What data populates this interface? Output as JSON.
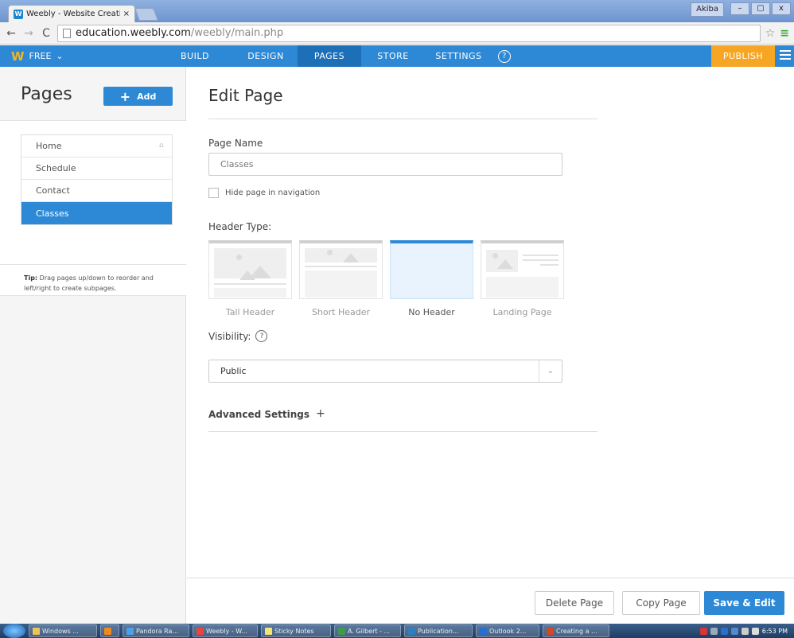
{
  "browser": {
    "tab_title": "Weebly - Website Creatio",
    "tab_close": "×",
    "url_host": "education.weebly.com",
    "url_path": "/weebly/main.php",
    "user_name": "Akiba",
    "min_label": "–",
    "max_label": "▢",
    "close_label": "x"
  },
  "topnav": {
    "plan_label": "FREE",
    "items": [
      "BUILD",
      "DESIGN",
      "PAGES",
      "STORE",
      "SETTINGS"
    ],
    "active": "PAGES",
    "help_label": "?",
    "publish_label": "PUBLISH"
  },
  "sidebar": {
    "title": "Pages",
    "add_label": "Add",
    "pages": [
      {
        "label": "Home",
        "home": true
      },
      {
        "label": "Schedule"
      },
      {
        "label": "Contact"
      },
      {
        "label": "Classes",
        "active": true
      }
    ],
    "tip_label": "Tip:",
    "tip_text": "Drag pages up/down to reorder and left/right to create subpages."
  },
  "editor": {
    "title": "Edit Page",
    "page_name_label": "Page Name",
    "page_name_value": "Classes",
    "hide_nav_label": "Hide page in navigation",
    "header_type_label": "Header Type:",
    "header_types": [
      "Tall Header",
      "Short Header",
      "No Header",
      "Landing Page"
    ],
    "selected_header": "No Header",
    "visibility_label": "Visibility:",
    "visibility_value": "Public",
    "advanced_label": "Advanced Settings",
    "advanced_toggle": "+"
  },
  "footer": {
    "delete_label": "Delete Page",
    "copy_label": "Copy Page",
    "save_label": "Save & Edit"
  },
  "taskbar": {
    "items": [
      "Windows ...",
      "",
      "Pandora Ra...",
      "Weebly - W...",
      "Sticky Notes",
      "A. Gilbert - ...",
      "Publication...",
      "Outlook 2...",
      "Creating a ..."
    ],
    "clock": "6:53 PM"
  },
  "colors": {
    "brand_blue": "#2d89d6",
    "publish_orange": "#f6a623",
    "logo_yellow": "#f5b51f"
  }
}
